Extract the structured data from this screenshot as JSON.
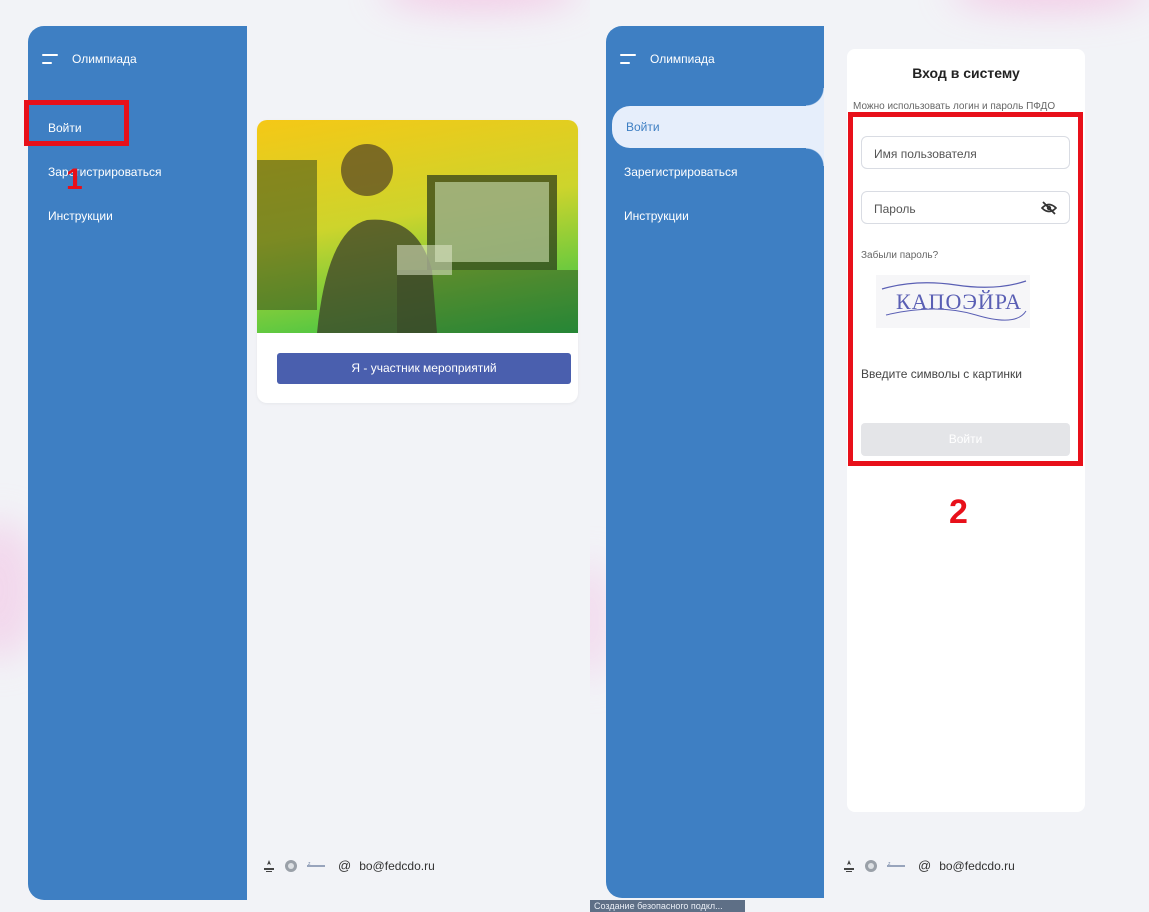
{
  "left": {
    "brand": "Олимпиада",
    "nav": [
      "Войти",
      "Зарегистрироваться",
      "Инструкции"
    ],
    "annotation_number": "1",
    "card_button": "Я - участник мероприятий",
    "footer_email": "bo@fedcdo.ru"
  },
  "right": {
    "brand": "Олимпиада",
    "nav": [
      "Войти",
      "Зарегистрироваться",
      "Инструкции"
    ],
    "form": {
      "title": "Вход в систему",
      "hint": "Можно использовать логин и пароль ПФДО",
      "username_placeholder": "Имя пользователя",
      "password_placeholder": "Пароль",
      "forgot": "Забыли пароль?",
      "captcha_text": "КАПОЭЙРА",
      "captcha_hint": "Введите символы с картинки",
      "submit": "Войти"
    },
    "annotation_number": "2",
    "footer_email": "bo@fedcdo.ru"
  },
  "statusbar": "Создание безопасного подкл...",
  "colors": {
    "sidebar": "#3e7fc3",
    "annotation_red": "#e8101a",
    "primary_button": "#4a5fae",
    "active_nav_bg": "#e6eefb"
  }
}
